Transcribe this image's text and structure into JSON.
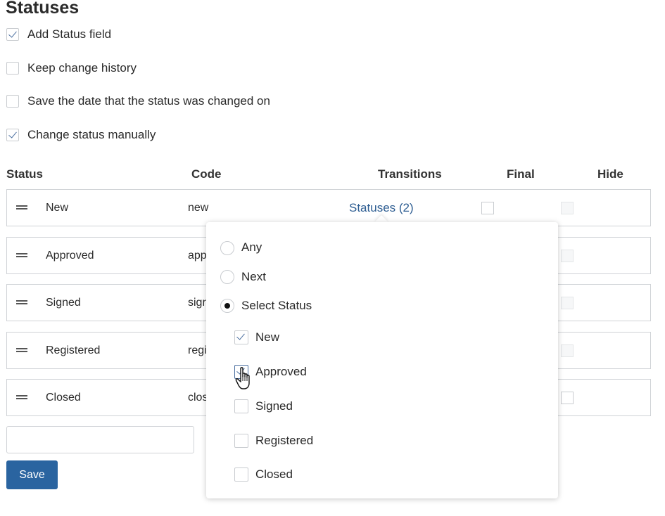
{
  "page": {
    "title": "Statuses"
  },
  "options": [
    {
      "label": "Add Status field",
      "checked": true
    },
    {
      "label": "Keep change history",
      "checked": false
    },
    {
      "label": "Save the date that the status was changed on",
      "checked": false
    },
    {
      "label": "Change status manually",
      "checked": true
    }
  ],
  "table": {
    "headers": {
      "status": "Status",
      "code": "Code",
      "transitions": "Transitions",
      "final": "Final",
      "hide": "Hide"
    },
    "rows": [
      {
        "status": "New",
        "code": "new",
        "transitions": "Statuses (2)"
      },
      {
        "status": "Approved",
        "code": "app"
      },
      {
        "status": "Signed",
        "code": "sigr"
      },
      {
        "status": "Registered",
        "code": "regi"
      },
      {
        "status": "Closed",
        "code": "clos"
      }
    ]
  },
  "actions": {
    "save_label": "Save"
  },
  "transitions_popup": {
    "modes": [
      {
        "label": "Any",
        "selected": false
      },
      {
        "label": "Next",
        "selected": false
      },
      {
        "label": "Select Status",
        "selected": true
      }
    ],
    "statuses": [
      {
        "label": "New",
        "checked": true
      },
      {
        "label": "Approved",
        "checked": true
      },
      {
        "label": "Signed",
        "checked": false
      },
      {
        "label": "Registered",
        "checked": false
      },
      {
        "label": "Closed",
        "checked": false
      }
    ]
  },
  "colors": {
    "link": "#2d5d92",
    "primary_button": "#2a64a0",
    "check": "#4b6fa0"
  }
}
